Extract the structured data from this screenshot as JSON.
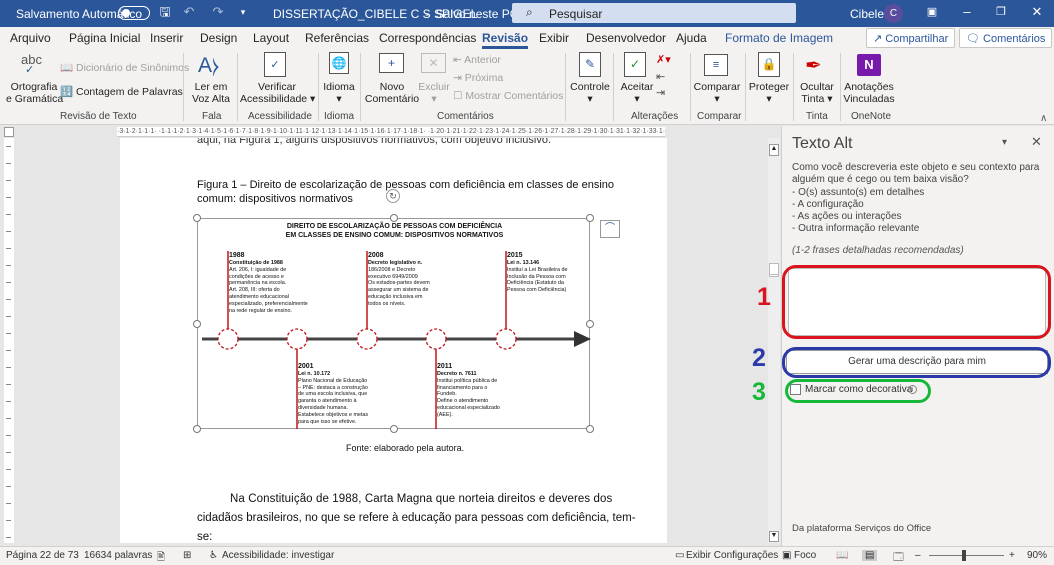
{
  "titlebar": {
    "autosave_label": "Salvamento Automático",
    "autosave_state": "Desativado",
    "doc_title": "DISSERTAÇÃO_CIBELE C S SPIGEL",
    "save_status": "Salvo neste PC",
    "search_placeholder": "Pesquisar",
    "user_name": "Cibele",
    "user_initial": "C"
  },
  "tabs": [
    "Arquivo",
    "Página Inicial",
    "Inserir",
    "Design",
    "Layout",
    "Referências",
    "Correspondências",
    "Revisão",
    "Exibir",
    "Desenvolvedor",
    "Ajuda",
    "Formato de Imagem"
  ],
  "active_tab": "Revisão",
  "header_buttons": {
    "share": "Compartilhar",
    "comments": "Comentários"
  },
  "ribbon": {
    "spelling": {
      "line1": "Ortografia",
      "line2": "e Gramática"
    },
    "thesaurus": "Dicionário de Sinônimos",
    "word_count": "Contagem de Palavras",
    "group_proofing": "Revisão de Texto",
    "read_aloud": {
      "line1": "Ler em",
      "line2": "Voz Alta"
    },
    "group_speech": "Fala",
    "check_access": {
      "line1": "Verificar",
      "line2": "Acessibilidade"
    },
    "group_access": "Acessibilidade",
    "language": "Idioma",
    "group_language": "Idioma",
    "new_comment": {
      "line1": "Novo",
      "line2": "Comentário"
    },
    "delete": "Excluir",
    "previous": "Anterior",
    "next": "Próxima",
    "show_comments": "Mostrar Comentários",
    "group_comments": "Comentários",
    "tracking": "Controle",
    "accept": "Aceitar",
    "group_changes": "Alterações",
    "compare": "Comparar",
    "group_compare": "Comparar",
    "protect": "Proteger",
    "hide_ink": {
      "line1": "Ocultar",
      "line2": "Tinta"
    },
    "group_ink": "Tinta",
    "linked_notes": {
      "line1": "Anotações",
      "line2": "Vinculadas"
    },
    "group_onenote": "OneNote"
  },
  "document": {
    "top_cut_line": "aqui, na Figura 1, alguns dispositivos normativos, com objetivo inclusivo.",
    "caption_line1": "Figura 1 – Direito de escolarização de pessoas com deficiência em classes de ensino",
    "caption_line2": "comum: dispositivos normativos",
    "figure_title_line1": "DIREITO DE ESCOLARIZAÇÃO DE PESSOAS COM DEFICIÊNCIA",
    "figure_title_line2": "EM CLASSES DE ENSINO COMUM: DISPOSITIVOS NORMATIVOS",
    "timeline_top": [
      {
        "year": "1988",
        "law": "Constituição de 1988",
        "lines": [
          "Art. 206, I: igualdade de",
          "condições de acesso e",
          "permanência na escola.",
          "Art. 208, III: oferta do",
          "atendimento educacional",
          "especializado, preferencialmente",
          "na rede regular de ensino."
        ]
      },
      {
        "year": "2008",
        "law": "Decreto legislativo n.",
        "lines": [
          "186/2008 e Decreto",
          "executivo 6949/2009",
          "Os estados-partes devem",
          "assegurar um sistema de",
          "educação inclusiva em",
          "todos os níveis."
        ]
      },
      {
        "year": "2015",
        "law": "Lei n. 13.146",
        "lines": [
          "Instituí a Lei Brasileira de",
          "Inclusão da Pessoa com",
          "Deficiência (Estatuto da",
          "Pessoa com Deficiência)"
        ]
      }
    ],
    "timeline_bottom": [
      {
        "year": "2001",
        "law": "Lei n. 10.172",
        "lines": [
          "Plano Nacional de Educação",
          "– PNE: destaca a construção",
          "de uma escola inclusiva, que",
          "garanta o atendimento à",
          "diversidade humana.",
          "Estabelece objetivos e metas",
          "para que isso se efetive."
        ]
      },
      {
        "year": "2011",
        "law": "Decreto n. 7611",
        "lines": [
          "Institui política pública de",
          "financiamento para o",
          "Fundeb.",
          "Define o atendimento",
          "educacional especializado",
          "(AEE)."
        ]
      }
    ],
    "source": "Fonte: elaborado pela autora.",
    "para_line1": "Na Constituição de 1988, Carta Magna que norteia direitos e deveres dos",
    "para_line2": "cidadãos brasileiros, no que se refere à educação para pessoas com deficiência, tem-",
    "para_line3": "se:"
  },
  "alt_pane": {
    "title": "Texto Alt",
    "q_line1": "Como você descreveria este objeto e seu contexto para",
    "q_line2": "alguém que é cego ou tem baixa visão?",
    "bullets": [
      "- O(s) assunto(s) em detalhes",
      "- A configuração",
      "- As ações ou interações",
      "- Outra informação relevante"
    ],
    "hint": "(1-2 frases detalhadas recomendadas)",
    "alt_text_value": "",
    "generate_button": "Gerar uma descrição para mim",
    "decorative_label": "Marcar como decorativa",
    "footer": "Da plataforma Serviços do Office",
    "markers": [
      "1",
      "2",
      "3"
    ],
    "marker_colors": [
      "#d9141e",
      "#2b3aa8",
      "#16b83a"
    ]
  },
  "status": {
    "page": "Página 22 de 73",
    "words": "16634 palavras",
    "accessibility": "Acessibilidade: investigar",
    "display_settings": "Exibir Configurações",
    "focus": "Foco",
    "zoom": "90%"
  }
}
